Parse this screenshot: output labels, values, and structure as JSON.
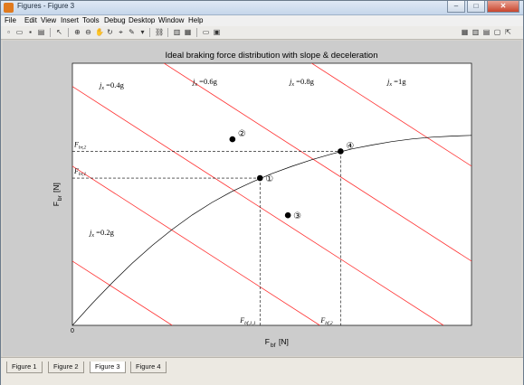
{
  "window": {
    "title": "Figures - Figure 3"
  },
  "menu": [
    "File",
    "Edit",
    "View",
    "Insert",
    "Tools",
    "Debug",
    "Desktop",
    "Window",
    "Help"
  ],
  "toolbar": {
    "icons": [
      "new-icon",
      "open-icon",
      "save-icon",
      "print-icon",
      "pointer-icon",
      "zoom-in-icon",
      "zoom-out-icon",
      "pan-icon",
      "rotate-icon",
      "datacursor-icon",
      "brush-icon",
      "link-icon",
      "colorbar-icon",
      "legend-icon",
      "hide-tools-icon",
      "plot-tools-icon"
    ]
  },
  "tabs": [
    "Figure 1",
    "Figure 2",
    "Figure 3",
    "Figure 4"
  ],
  "active_tab": 2,
  "chart_data": {
    "type": "line",
    "title": "Ideal braking force distribution with slope & deceleration",
    "xlabel": "F",
    "xlabel_sub": "bf",
    "xlabel_unit": "[N]",
    "ylabel": "F",
    "ylabel_sub": "br",
    "ylabel_unit": "[N]",
    "origin_tick": "0",
    "axis_range_note": "axes unlabelled except origin",
    "xlim": [
      0,
      1
    ],
    "ylim": [
      0,
      1
    ],
    "grid": false,
    "ideal_curve": {
      "x": [
        0,
        0.05,
        0.1,
        0.15,
        0.2,
        0.25,
        0.3,
        0.35,
        0.4,
        0.45,
        0.5,
        0.55,
        0.6,
        0.65,
        0.7,
        0.75,
        0.8,
        0.85,
        0.9,
        0.95,
        1.0
      ],
      "y": [
        0,
        0.084,
        0.163,
        0.237,
        0.305,
        0.366,
        0.421,
        0.469,
        0.511,
        0.547,
        0.579,
        0.607,
        0.632,
        0.654,
        0.673,
        0.688,
        0.701,
        0.711,
        0.718,
        0.722,
        0.725
      ]
    },
    "deceleration_lines": [
      {
        "label": "j",
        "label_sub": "x",
        "label_value": "=0.2g",
        "x0": 0.25,
        "y_at_x0": 0
      },
      {
        "label": "j",
        "label_sub": "x",
        "label_value": "=0.4g",
        "x0": 0.62,
        "y_at_x0": 0
      },
      {
        "label": "j",
        "label_sub": "x",
        "label_value": "=0.6g",
        "x0": 0.93,
        "y_at_x0": 0
      },
      {
        "label": "j",
        "label_sub": "x",
        "label_value": "=0.8g",
        "x0": 1.25,
        "y_at_x0": 0
      },
      {
        "label": "j",
        "label_sub": "x",
        "label_value": "=1g",
        "x0": 1.62,
        "y_at_x0": 0
      }
    ],
    "line_slope": -0.98,
    "points": [
      {
        "marker": "①",
        "x": 0.47,
        "y": 0.562
      },
      {
        "marker": "②",
        "x": 0.401,
        "y": 0.71
      },
      {
        "marker": "③",
        "x": 0.54,
        "y": 0.42
      },
      {
        "marker": "④",
        "x": 0.672,
        "y": 0.664
      }
    ],
    "annotations": [
      {
        "text": "F",
        "sub": "br,2",
        "y": 0.664,
        "side": "y"
      },
      {
        "text": "F",
        "sub": "br,1",
        "y": 0.562,
        "side": "y"
      },
      {
        "text": "F",
        "sub": "bf,1,1",
        "x": 0.47,
        "side": "x"
      },
      {
        "text": "F",
        "sub": "bf,2",
        "x": 0.672,
        "side": "x"
      }
    ],
    "colors": {
      "curve": "#000000",
      "lines": "#ff3030",
      "dashed": "#000000",
      "plot_bg": "#ffffff"
    }
  }
}
